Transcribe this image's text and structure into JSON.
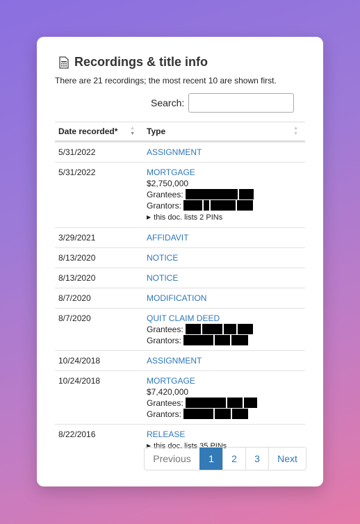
{
  "card": {
    "title": "Recordings & title info",
    "intro": "There are 21 recordings; the most recent 10 are shown first."
  },
  "search": {
    "label": "Search:",
    "value": "",
    "placeholder": ""
  },
  "table": {
    "headers": {
      "date": "Date recorded*",
      "type": "Type"
    },
    "rows": [
      {
        "date": "5/31/2022",
        "type": "ASSIGNMENT"
      },
      {
        "date": "5/31/2022",
        "type": "MORTGAGE",
        "amount": "$2,750,000",
        "grantees_label": "Grantees:",
        "grantors_label": "Grantors:",
        "pins": "this doc. lists 2 PINs"
      },
      {
        "date": "3/29/2021",
        "type": "AFFIDAVIT"
      },
      {
        "date": "8/13/2020",
        "type": "NOTICE"
      },
      {
        "date": "8/13/2020",
        "type": "NOTICE"
      },
      {
        "date": "8/7/2020",
        "type": "MODIFICATION"
      },
      {
        "date": "8/7/2020",
        "type": "QUIT CLAIM DEED",
        "grantees_label": "Grantees:",
        "grantors_label": "Grantors:"
      },
      {
        "date": "10/24/2018",
        "type": "ASSIGNMENT"
      },
      {
        "date": "10/24/2018",
        "type": "MORTGAGE",
        "amount": "$7,420,000",
        "grantees_label": "Grantees:",
        "grantors_label": "Grantors:"
      },
      {
        "date": "8/22/2016",
        "type": "RELEASE",
        "pins": "this doc. lists 35 PINs"
      }
    ]
  },
  "pagination": {
    "previous": "Previous",
    "pages": [
      "1",
      "2",
      "3"
    ],
    "current": "1",
    "next": "Next"
  },
  "colors": {
    "link": "#2f77b8",
    "active_page": "#337ab7",
    "redaction": "#000000"
  }
}
